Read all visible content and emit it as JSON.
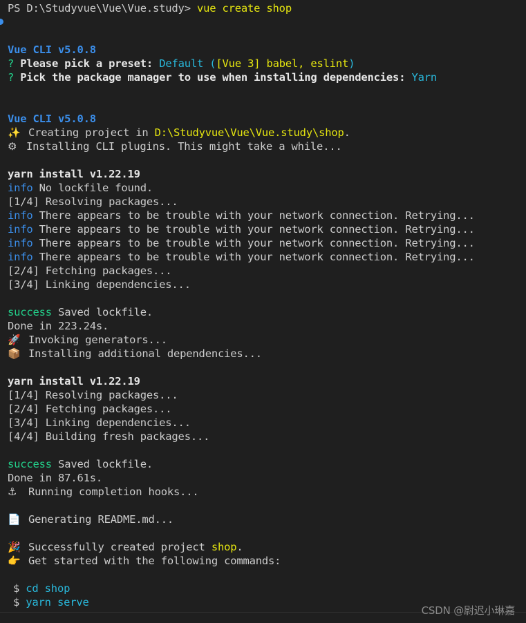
{
  "prompt": {
    "ps": "PS D:\\Studyvue\\Vue\\Vue.study>",
    "command": "vue create shop"
  },
  "cli_header_1": "Vue CLI v5.0.8",
  "preset_q": "?",
  "preset_label": "Please pick a preset:",
  "preset_default": "Default",
  "preset_open": "(",
  "preset_value": "[Vue 3] babel, eslint",
  "preset_close": ")",
  "pm_q": "?",
  "pm_label": "Pick the package manager to use when installing dependencies:",
  "pm_value": "Yarn",
  "cli_header_2": "Vue CLI v5.0.8",
  "creating_text": "Creating project in",
  "creating_path": "D:\\Studyvue\\Vue\\Vue.study\\shop",
  "creating_dot": ".",
  "installing_plugins": "Installing CLI plugins. This might take a while...",
  "yarn1": {
    "header": "yarn install v1.22.19",
    "info_tag": "info",
    "no_lockfile": "No lockfile found.",
    "step1": "[1/4] Resolving packages...",
    "retry_msgs": [
      "There appears to be trouble with your network connection. Retrying...",
      "There appears to be trouble with your network connection. Retrying...",
      "There appears to be trouble with your network connection. Retrying...",
      "There appears to be trouble with your network connection. Retrying..."
    ],
    "step2": "[2/4] Fetching packages...",
    "step3": "[3/4] Linking dependencies...",
    "success_tag": "success",
    "saved": "Saved lockfile.",
    "done": "Done in 223.24s."
  },
  "invoking": "Invoking generators...",
  "installing_additional": "Installing additional dependencies...",
  "yarn2": {
    "header": "yarn install v1.22.19",
    "step1": "[1/4] Resolving packages...",
    "step2": "[2/4] Fetching packages...",
    "step3": "[3/4] Linking dependencies...",
    "step4": "[4/4] Building fresh packages...",
    "success_tag": "success",
    "saved": "Saved lockfile.",
    "done": "Done in 87.61s."
  },
  "hooks": "Running completion hooks...",
  "readme": "Generating README.md...",
  "success_text": "Successfully created project",
  "success_name": "shop",
  "success_dot": ".",
  "get_started": "Get started with the following commands:",
  "commands": [
    {
      "dollar": "$",
      "cmd": "cd shop"
    },
    {
      "dollar": "$",
      "cmd": "yarn serve"
    }
  ],
  "watermark": "CSDN @尉迟小琳嘉",
  "icons": {
    "sparkle": "sparkles-icon",
    "gear": "gear-icon",
    "rocket": "rocket-icon",
    "box": "package-icon",
    "anchor": "anchor-icon",
    "doc": "document-icon",
    "party": "party-popper-icon",
    "hand": "pointing-hand-icon"
  },
  "colors": {
    "background": "#1f1f1f",
    "text": "#cccccc",
    "blue": "#3b8eea",
    "cyan": "#29b8db",
    "yellow": "#e5e510",
    "green": "#23d18b"
  }
}
